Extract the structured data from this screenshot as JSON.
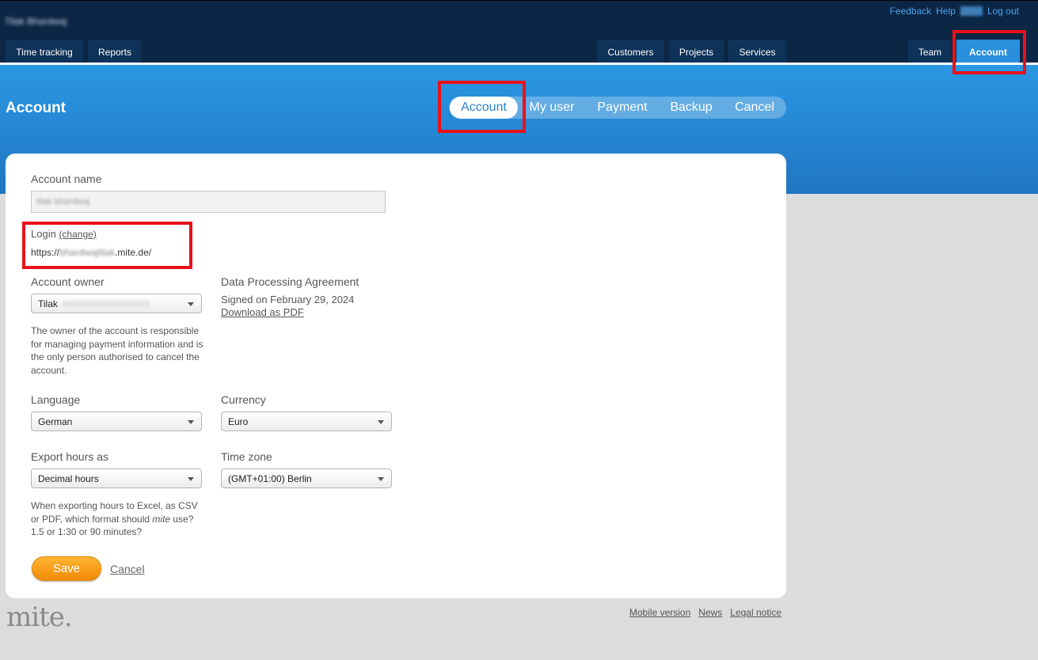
{
  "topbar": {
    "org_name": "Tilak Bhardwaj",
    "links": {
      "feedback": "Feedback",
      "help": "Help",
      "logout": "Log out"
    },
    "tabs_left": [
      "Time tracking",
      "Reports"
    ],
    "tabs_middle": [
      "Customers",
      "Projects",
      "Services"
    ],
    "tabs_right": [
      "Team",
      "Account"
    ],
    "active_tab": "Account"
  },
  "page": {
    "title": "Account",
    "subnav": [
      "Account",
      "My user",
      "Payment",
      "Backup",
      "Cancel"
    ],
    "active_subnav": "Account"
  },
  "form": {
    "account_name_label": "Account name",
    "account_name_value": "tilak bhardwaj",
    "login_label": "Login",
    "login_change": "(change)",
    "login_url_prefix": "https://",
    "login_url_blurred": "bhardwajtilak",
    "login_url_suffix": ".mite.de/",
    "owner_label": "Account owner",
    "owner_value": "Tilak",
    "owner_help": "The owner of the account is responsible for managing payment information and is the only person authorised to cancel the account.",
    "dpa_label": "Data Processing Agreement",
    "dpa_signed": "Signed on February 29, 2024",
    "dpa_download": "Download as PDF",
    "language_label": "Language",
    "language_value": "German",
    "currency_label": "Currency",
    "currency_value": "Euro",
    "export_label": "Export hours as",
    "export_value": "Decimal hours",
    "timezone_label": "Time zone",
    "timezone_value": "(GMT+01:00) Berlin",
    "export_help_1": "When exporting hours to Excel, as CSV or PDF, which format should ",
    "export_help_em": "mite",
    "export_help_2": " use? 1.5 or 1:30 or 90 minutes?",
    "save_label": "Save",
    "cancel_label": "Cancel"
  },
  "footer": {
    "logo": "mite.",
    "links": [
      "Mobile version",
      "News",
      "Legal notice"
    ]
  },
  "colors": {
    "topbar": "#0c2645",
    "band": "#2585d2",
    "active_tab": "#2a8fdc",
    "save": "#f59a12",
    "highlight": "#e8111b"
  }
}
